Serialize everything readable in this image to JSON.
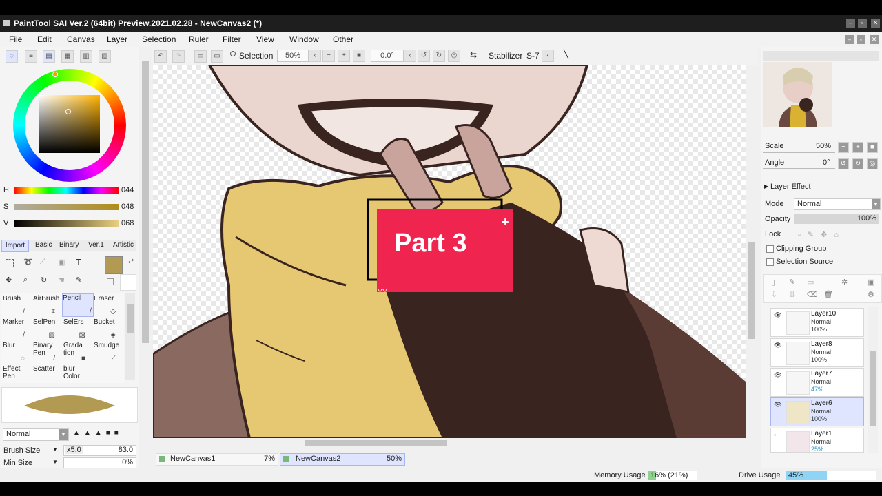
{
  "app": {
    "title": "PaintTool SAI Ver.2 (64bit) Preview.2021.02.28 - NewCanvas2 (*)",
    "window_buttons": [
      "–",
      "▫",
      "✕"
    ]
  },
  "menu": [
    "File",
    "Edit",
    "Canvas",
    "Layer",
    "Selection",
    "Ruler",
    "Filter",
    "View",
    "Window",
    "Other"
  ],
  "toolbar": {
    "selection_label": "Selection",
    "zoom": "50%",
    "rotation": "0.0°",
    "stabilizer_label": "Stabilizer",
    "stabilizer_value": "S-7"
  },
  "color_panel": {
    "h_label": "H",
    "h_value": "044",
    "s_label": "S",
    "s_value": "048",
    "v_label": "V",
    "v_value": "068",
    "current_color": "#b39a52"
  },
  "tool_tabs": [
    "Import",
    "Basic",
    "Binary",
    "Ver.1",
    "Artistic"
  ],
  "tools": [
    {
      "label": "Brush"
    },
    {
      "label": "AirBrush"
    },
    {
      "label": "Pencil"
    },
    {
      "label": "Eraser"
    },
    {
      "label": "Marker"
    },
    {
      "label": "SelPen"
    },
    {
      "label": "SelErs"
    },
    {
      "label": "Bucket"
    },
    {
      "label": "Blur"
    },
    {
      "label": "Binary Pen"
    },
    {
      "label": "Grada tion"
    },
    {
      "label": "Smudge"
    },
    {
      "label": "Effect Pen"
    },
    {
      "label": "Scatter"
    },
    {
      "label": "blur Color"
    }
  ],
  "brush": {
    "blend_mode": "Normal",
    "size_label": "Brush Size",
    "size_multiplier": "x5.0",
    "size_value": "83.0",
    "min_size_label": "Min Size",
    "min_size_value": "0%"
  },
  "canvas_tabs": [
    {
      "name": "NewCanvas1",
      "zoom": "7%"
    },
    {
      "name": "NewCanvas2",
      "zoom": "50%"
    }
  ],
  "overlay": {
    "text": "Part 3",
    "color": "#f0254f"
  },
  "navigator": {
    "scale_label": "Scale",
    "scale_value": "50%",
    "angle_label": "Angle",
    "angle_value": "0°"
  },
  "layer_panel": {
    "effect_label": "Layer Effect",
    "mode_label": "Mode",
    "mode_value": "Normal",
    "opacity_label": "Opacity",
    "opacity_value": "100%",
    "lock_label": "Lock",
    "clipping_label": "Clipping Group",
    "selection_source_label": "Selection Source",
    "layers": [
      {
        "name": "Layer10",
        "mode": "Normal",
        "opacity": "100%"
      },
      {
        "name": "Layer8",
        "mode": "Normal",
        "opacity": "100%"
      },
      {
        "name": "Layer7",
        "mode": "Normal",
        "opacity": "47%"
      },
      {
        "name": "Layer6",
        "mode": "Normal",
        "opacity": "100%"
      },
      {
        "name": "Layer1",
        "mode": "Normal",
        "opacity": "25%"
      }
    ]
  },
  "status": {
    "memory_label": "Memory Usage",
    "memory_value": "16% (21%)",
    "memory_fraction": 0.16,
    "drive_label": "Drive Usage",
    "drive_value": "45%",
    "drive_fraction": 0.45
  }
}
